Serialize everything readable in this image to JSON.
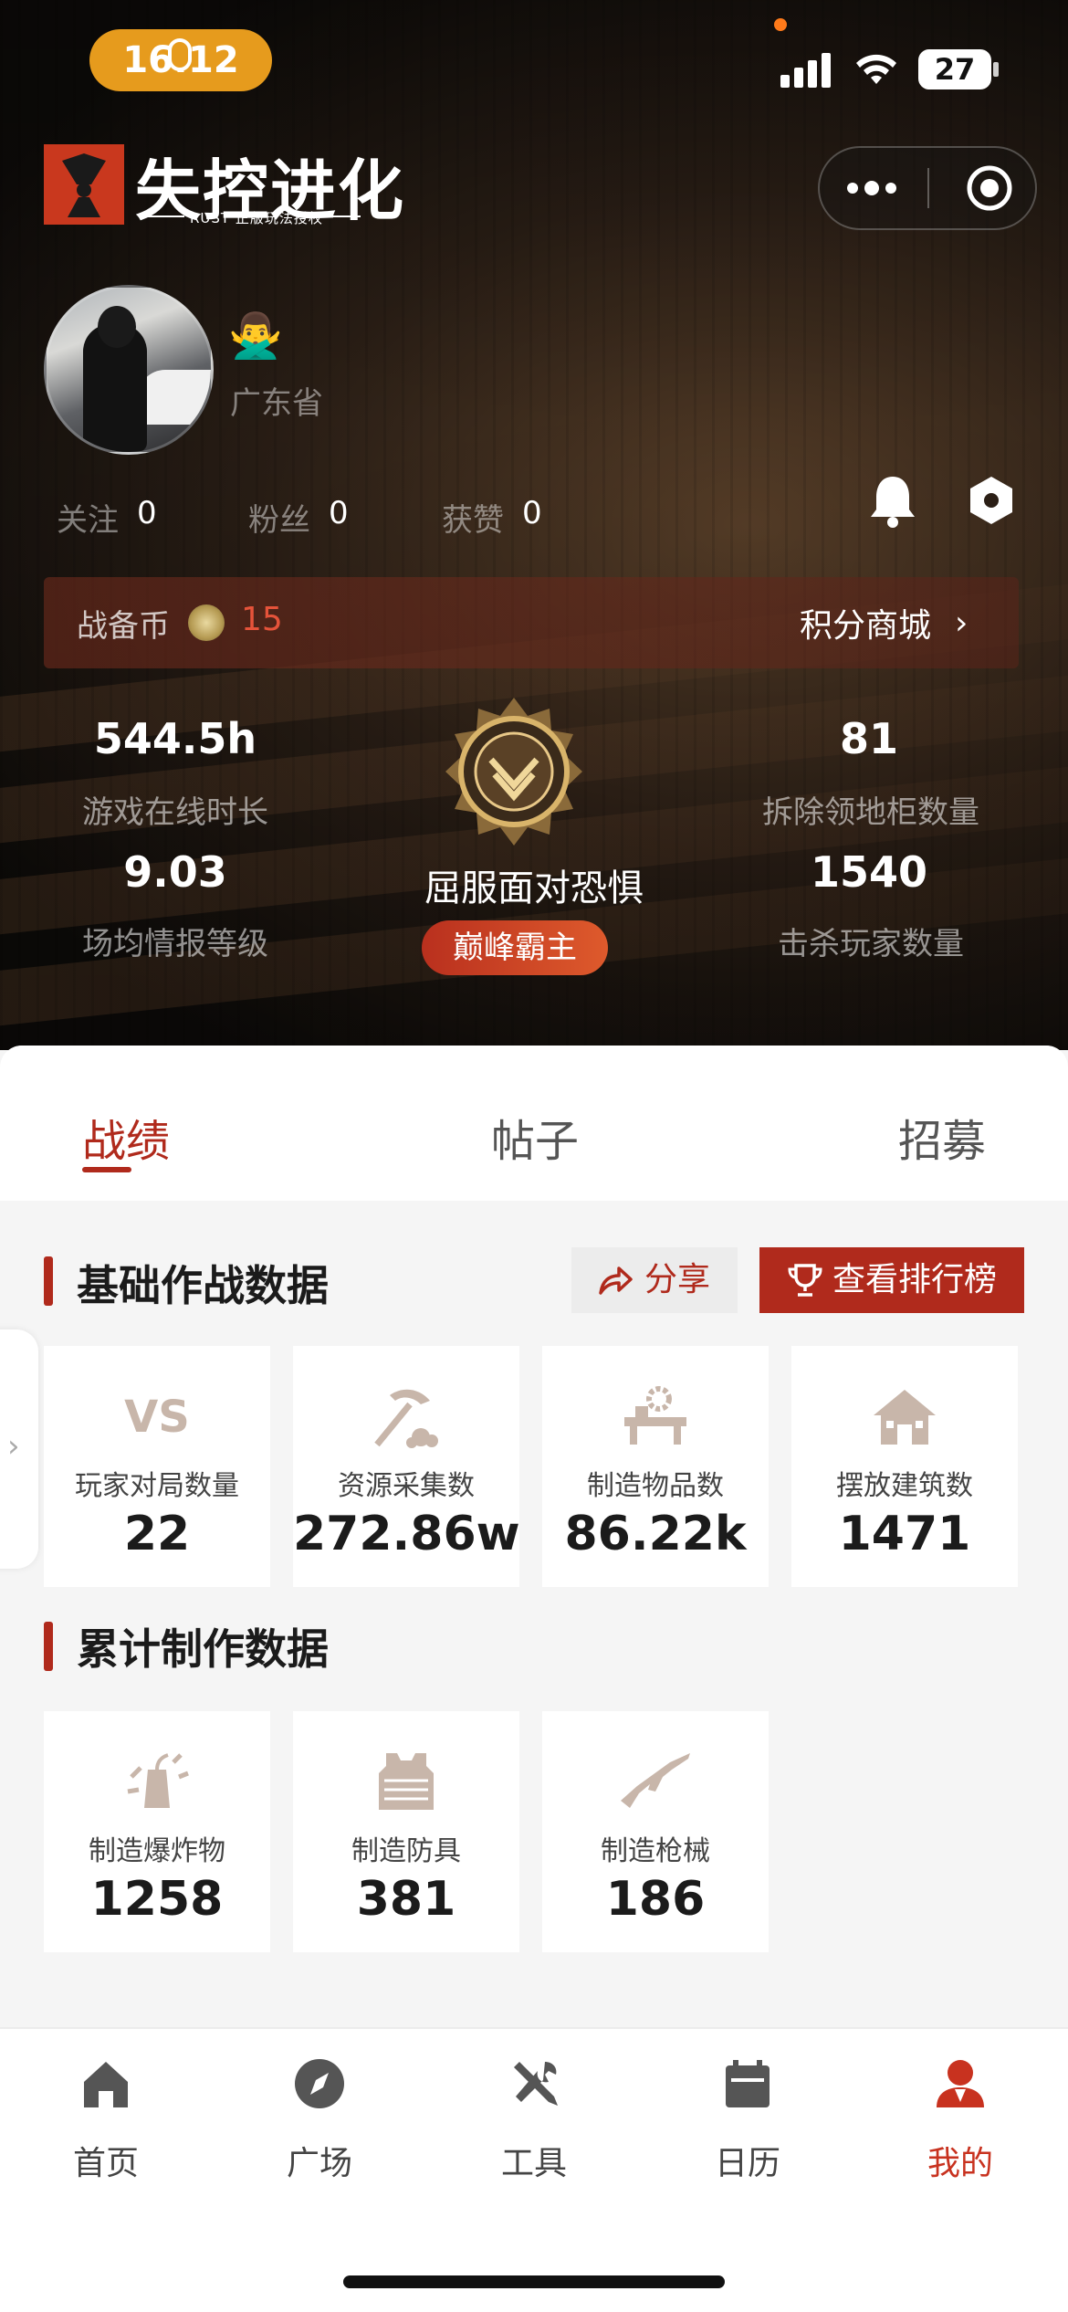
{
  "status_bar": {
    "time": "16:12",
    "battery": "27"
  },
  "logo": {
    "title": "失控进化",
    "subtitle": "RUST 正版玩法授权"
  },
  "profile": {
    "location": "广东省",
    "gender_icon": "🙅‍♂️"
  },
  "social": {
    "following_label": "关注",
    "following_value": "0",
    "fans_label": "粉丝",
    "fans_value": "0",
    "likes_label": "获赞",
    "likes_value": "0"
  },
  "coins": {
    "label": "战备币",
    "value": "15",
    "mall_label": "积分商城",
    "mall_chevron": "›"
  },
  "stats": {
    "online_hours_value": "544.5h",
    "online_hours_label": "游戏在线时长",
    "intel_level_value": "9.03",
    "intel_level_label": "场均情报等级",
    "cabinets_value": "81",
    "cabinets_label": "拆除领地柜数量",
    "kills_value": "1540",
    "kills_label": "击杀玩家数量",
    "rank_title": "屈服面对恐惧",
    "rank_badge": "巅峰霸主"
  },
  "tabs": [
    {
      "label": "战绩"
    },
    {
      "label": "帖子"
    },
    {
      "label": "招募"
    }
  ],
  "combat_section": {
    "title": "基础作战数据",
    "share_label": "分享",
    "leaderboard_label": "查看排行榜",
    "cards": [
      {
        "label": "玩家对局数量",
        "value": "22",
        "icon": "vs-icon"
      },
      {
        "label": "资源采集数",
        "value": "272.86w",
        "icon": "pickaxe-icon"
      },
      {
        "label": "制造物品数",
        "value": "86.22k",
        "icon": "workbench-icon"
      },
      {
        "label": "摆放建筑数",
        "value": "1471",
        "icon": "house-icon"
      }
    ]
  },
  "craft_section": {
    "title": "累计制作数据",
    "cards": [
      {
        "label": "制造爆炸物",
        "value": "1258",
        "icon": "explosive-icon"
      },
      {
        "label": "制造防具",
        "value": "381",
        "icon": "armor-icon"
      },
      {
        "label": "制造枪械",
        "value": "186",
        "icon": "rifle-icon"
      }
    ]
  },
  "nav": [
    {
      "label": "首页",
      "icon": "home-icon"
    },
    {
      "label": "广场",
      "icon": "compass-icon"
    },
    {
      "label": "工具",
      "icon": "tools-icon"
    },
    {
      "label": "日历",
      "icon": "calendar-icon"
    },
    {
      "label": "我的",
      "icon": "profile-icon",
      "active": true
    }
  ],
  "colors": {
    "accent": "#b02a1c",
    "active_nav": "#c8321f",
    "coin_value": "#e5533a"
  }
}
